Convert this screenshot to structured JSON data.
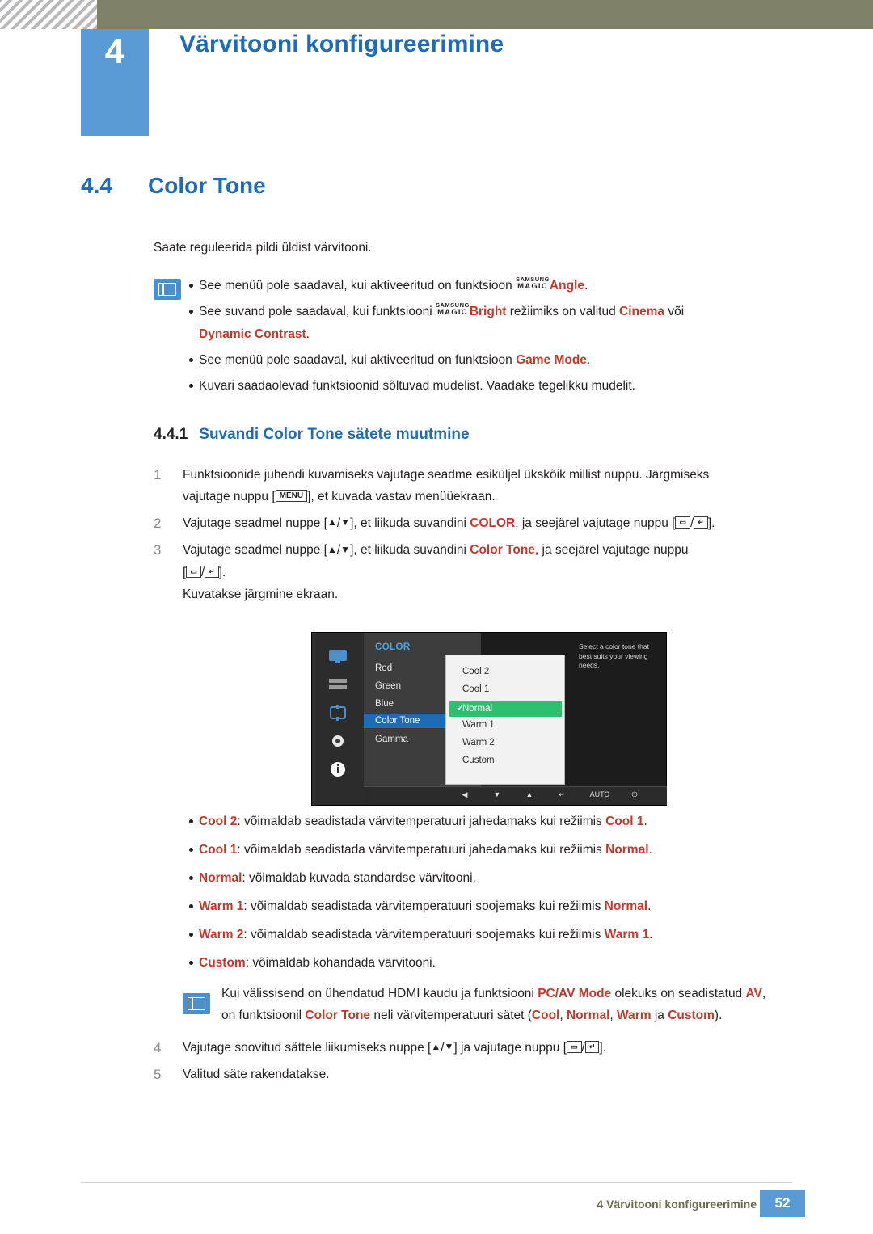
{
  "header": {
    "chapter_number": "4",
    "chapter_title": "Värvitooni konfigureerimine"
  },
  "section": {
    "number": "4.4",
    "title": "Color Tone"
  },
  "intro": "Saate reguleerida pildi üldist värvitooni.",
  "notes_1": [
    {
      "pre": "See menüü pole saadaval, kui aktiveeritud on funktsioon ",
      "magic": true,
      "magic_l1": "SAMSUNG",
      "magic_l2": "MAGIC",
      "term": "Angle",
      "post": "."
    },
    {
      "pre": "See suvand pole saadaval, kui funktsiooni ",
      "magic": true,
      "magic_l1": "SAMSUNG",
      "magic_l2": "MAGIC",
      "term": "Bright",
      "mid": " režiimiks on valitud ",
      "term2": "Cinema",
      "mid2": " või",
      "line2_term": "Dynamic Contrast",
      "line2_post": "."
    },
    {
      "pre": "See menüü pole saadaval, kui aktiveeritud on funktsioon ",
      "term": "Game Mode",
      "post": "."
    },
    {
      "pre": "Kuvari saadaolevad funktsioonid sõltuvad mudelist. Vaadake tegelikku mudelit.",
      "term": "",
      "post": ""
    }
  ],
  "subsection": {
    "number": "4.4.1",
    "title": "Suvandi Color Tone sätete muutmine"
  },
  "steps": [
    {
      "num": "1",
      "line1_a": "Funktsioonide juhendi kuvamiseks vajutage seadme esiküljel ükskõik millist nuppu. Järgmiseks",
      "line2_a": "vajutage nuppu [",
      "key": "MENU",
      "line2_b": "], et kuvada vastav menüüekraan."
    },
    {
      "num": "2",
      "line1_a": "Vajutage seadmel nuppe [",
      "glyph_up": "▲",
      "slash": "/",
      "glyph_dn": "▼",
      "line1_b": "], et liikuda suvandini ",
      "term": "COLOR",
      "line1_c": ", ja seejärel vajutage nuppu [",
      "line1_d": "]."
    },
    {
      "num": "3",
      "line1_a": "Vajutage seadmel nuppe [",
      "line1_b": "], et liikuda suvandini ",
      "term": "Color Tone",
      "line1_c": ", ja seejärel vajutage nuppu",
      "line2_a": "[",
      "line2_b": "].",
      "line3": "Kuvatakse järgmine ekraan."
    }
  ],
  "osd": {
    "menu_title": "COLOR",
    "menu_items": [
      "Red",
      "Green",
      "Blue",
      "Color Tone",
      "Gamma"
    ],
    "selected_menu_item": "Color Tone",
    "submenu_items": [
      "Cool 2",
      "Cool 1",
      "Normal",
      "Warm 1",
      "Warm 2",
      "Custom"
    ],
    "selected_submenu_item": "Normal",
    "check_glyph": "✔",
    "description": "Select a color tone that best suits your viewing needs.",
    "bottom_keys": [
      "◀",
      "▼",
      "▲",
      "↵",
      "AUTO",
      "⏻"
    ],
    "highlight_color": "#2fbf71",
    "menu_highlight_color": "#1e6bb8"
  },
  "options": [
    {
      "term": "Cool 2",
      "desc": ": võimaldab seadistada värvitemperatuuri jahedamaks kui režiimis ",
      "ref": "Cool 1",
      "post": "."
    },
    {
      "term": "Cool 1",
      "desc": ": võimaldab seadistada värvitemperatuuri jahedamaks kui režiimis ",
      "ref": "Normal",
      "post": "."
    },
    {
      "term": "Normal",
      "desc": ": võimaldab kuvada standardse värvitooni.",
      "ref": "",
      "post": ""
    },
    {
      "term": "Warm 1",
      "desc": ": võimaldab seadistada värvitemperatuuri soojemaks kui režiimis ",
      "ref": "Normal",
      "post": "."
    },
    {
      "term": "Warm 2",
      "desc": ": võimaldab seadistada värvitemperatuuri soojemaks kui režiimis ",
      "ref": "Warm 1",
      "post": "."
    },
    {
      "term": "Custom",
      "desc": ": võimaldab kohandada värvitooni.",
      "ref": "",
      "post": ""
    }
  ],
  "note_2": {
    "l1_a": "Kui välissisend on ühendatud HDMI kaudu ja funktsiooni ",
    "l1_term": "PC/AV Mode",
    "l1_b": " olekuks on seadistatud ",
    "l1_term2": "AV",
    "l1_c": ",",
    "l2_a": "on funktsioonil ",
    "l2_term": "Color Tone",
    "l2_b": " neli värvitemperatuuri sätet (",
    "l2_t1": "Cool",
    "l2_sep1": ", ",
    "l2_t2": "Normal",
    "l2_sep2": ", ",
    "l2_t3": "Warm",
    "l2_sep3": " ja ",
    "l2_t4": "Custom",
    "l2_c": ")."
  },
  "steps_2": [
    {
      "num": "4",
      "a": "Vajutage soovitud sättele liikumiseks nuppe [",
      "b": "] ja vajutage nuppu [",
      "c": "]."
    },
    {
      "num": "5",
      "a": "Valitud säte rakendatakse."
    }
  ],
  "footer": {
    "text": "4 Värvitooni konfigureerimine",
    "page": "52"
  }
}
